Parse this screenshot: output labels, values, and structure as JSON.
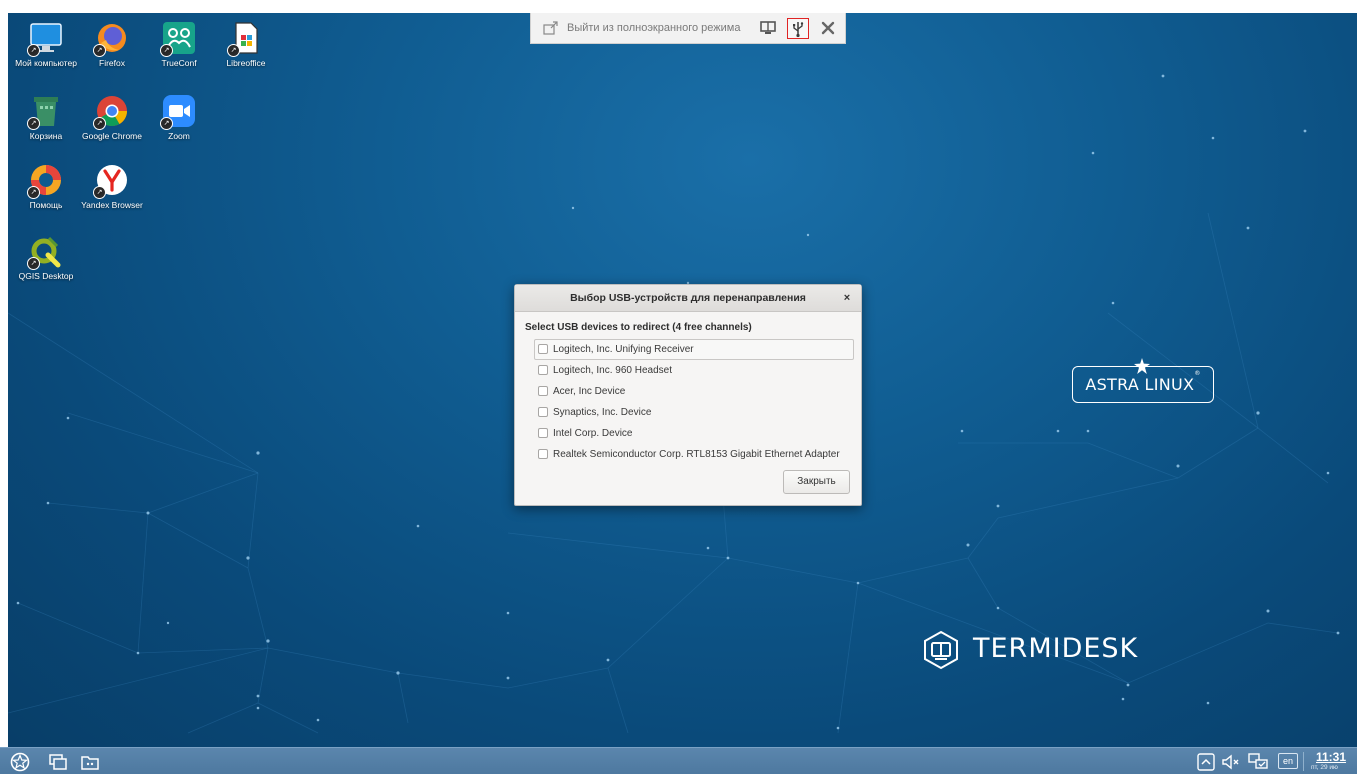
{
  "desktop_icons": [
    {
      "label": "Мой компьютер",
      "icon": "computer-icon"
    },
    {
      "label": "Firefox",
      "icon": "firefox-icon"
    },
    {
      "label": "TrueConf",
      "icon": "trueconf-icon"
    },
    {
      "label": "Libreoffice",
      "icon": "libreoffice-icon"
    },
    {
      "label": "Корзина",
      "icon": "trash-icon"
    },
    {
      "label": "Google Chrome",
      "icon": "chrome-icon"
    },
    {
      "label": "Zoom",
      "icon": "zoom-icon"
    },
    {
      "label": "Помощь",
      "icon": "help-lifebuoy-icon"
    },
    {
      "label": "Yandex Browser",
      "icon": "yandex-browser-icon"
    },
    {
      "label": "QGIS Desktop",
      "icon": "qgis-icon"
    }
  ],
  "fullscreen_bar": {
    "exit_label": "Выйти из полноэкранного режима",
    "buttons": [
      "monitor-layout-icon",
      "usb-icon",
      "close-icon"
    ]
  },
  "dialog": {
    "title": "Выбор USB-устройств для перенаправления",
    "close_glyph": "×",
    "heading": "Select USB devices to redirect (4 free channels)",
    "devices": [
      {
        "label": "Logitech, Inc. Unifying Receiver",
        "checked": false
      },
      {
        "label": "Logitech, Inc. 960 Headset",
        "checked": false
      },
      {
        "label": "Acer, Inc Device",
        "checked": false
      },
      {
        "label": "Synaptics, Inc. Device",
        "checked": false
      },
      {
        "label": "Intel Corp. Device",
        "checked": false
      },
      {
        "label": "Realtek Semiconductor Corp. RTL8153 Gigabit Ethernet Adapter",
        "checked": false
      }
    ],
    "close_button": "Закрыть"
  },
  "logos": {
    "astra": "ASTRA LINUX",
    "astra_reg": "®",
    "termidesk": "TERMIDESK"
  },
  "taskbar": {
    "left_icons": [
      "start-menu-icon",
      "windows-switcher-icon",
      "file-manager-icon"
    ],
    "tray_icons": [
      "tray-arrow-up-icon",
      "volume-muted-icon",
      "network-icon"
    ],
    "language": "en",
    "time": "11:31",
    "date": "пт, 29 ию"
  },
  "colors": {
    "wallpaper": "#0f5a8f",
    "taskbar": "#5580a8",
    "highlight": "#e02424"
  }
}
